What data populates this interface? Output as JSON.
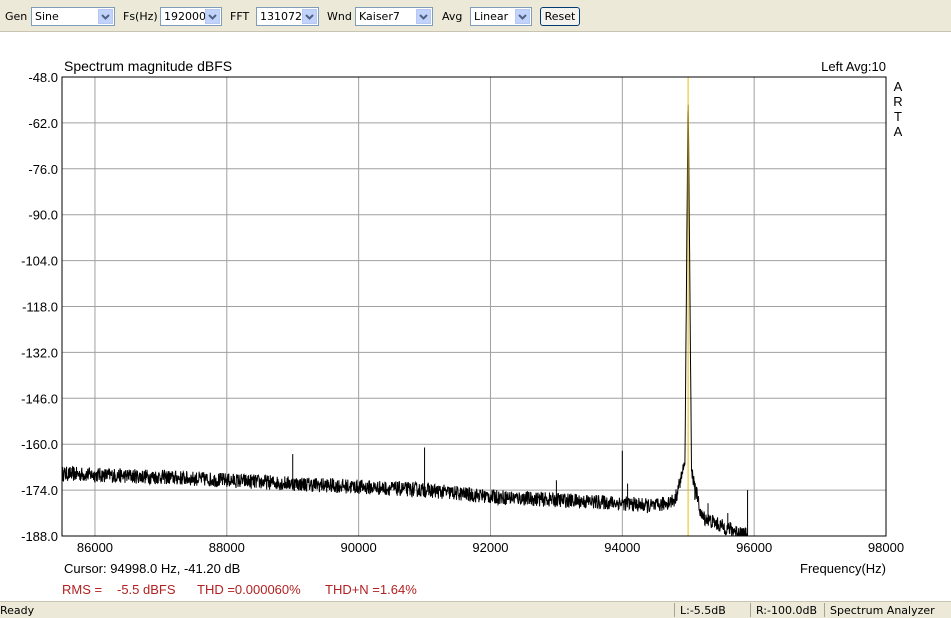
{
  "toolbar": {
    "gen_label": "Gen",
    "gen_value": "Sine",
    "fs_label": "Fs(Hz)",
    "fs_value": "192000",
    "fft_label": "FFT",
    "fft_value": "131072",
    "wnd_label": "Wnd",
    "wnd_value": "Kaiser7",
    "avg_label": "Avg",
    "avg_value": "Linear",
    "reset_label": "Reset"
  },
  "chart": {
    "title": "Spectrum magnitude dBFS",
    "channel_info": "Left  Avg:10",
    "watermark": [
      "A",
      "R",
      "T",
      "A"
    ],
    "cursor_text": "Cursor: 94998.0 Hz, -41.20 dB",
    "rms_label": "RMS =",
    "rms_value": "-5.5 dBFS",
    "thd_text": "THD =0.000060%",
    "thdn_text": "THD+N =1.64%",
    "x_axis_label": "Frequency(Hz)"
  },
  "chart_data": {
    "type": "line",
    "title": "Spectrum magnitude dBFS",
    "xlabel": "Frequency(Hz)",
    "ylabel": "",
    "xlim": [
      85500,
      98000
    ],
    "ylim": [
      -188,
      -48
    ],
    "x_ticks": [
      86000,
      88000,
      90000,
      92000,
      94000,
      96000,
      98000
    ],
    "y_ticks": [
      -48.0,
      -62.0,
      -76.0,
      -90.0,
      -104.0,
      -118.0,
      -132.0,
      -146.0,
      -160.0,
      -174.0,
      -188.0
    ],
    "grid": true,
    "cursor_x": 94998.0,
    "noise_floor": [
      [
        85500,
        -169
      ],
      [
        87000,
        -170
      ],
      [
        88000,
        -171
      ],
      [
        89000,
        -172
      ],
      [
        90000,
        -173
      ],
      [
        91000,
        -174
      ],
      [
        92000,
        -176
      ],
      [
        93000,
        -177
      ],
      [
        94000,
        -178
      ],
      [
        94500,
        -179
      ],
      [
        94800,
        -177
      ],
      [
        94950,
        -166
      ],
      [
        94998,
        -52
      ],
      [
        95050,
        -168
      ],
      [
        95200,
        -182
      ],
      [
        95500,
        -185
      ],
      [
        95800,
        -187
      ],
      [
        95900,
        -188
      ]
    ],
    "spurs": [
      [
        89000,
        -163
      ],
      [
        91000,
        -161
      ],
      [
        93000,
        -171
      ],
      [
        94000,
        -162
      ],
      [
        94080,
        -172
      ],
      [
        95100,
        -177
      ],
      [
        95300,
        -178
      ],
      [
        95600,
        -181
      ],
      [
        95900,
        -174
      ]
    ],
    "series": [
      {
        "values": "noise_floor"
      }
    ]
  },
  "colors": {
    "trace": "#000000",
    "cursor": "#e6c000",
    "grid": "#a0a0a0",
    "stats_text": "#b22222"
  },
  "status": {
    "ready": "Ready",
    "left_level": "L:-5.5dB",
    "right_level": "R:-100.0dB",
    "mode": "Spectrum Analyzer"
  }
}
